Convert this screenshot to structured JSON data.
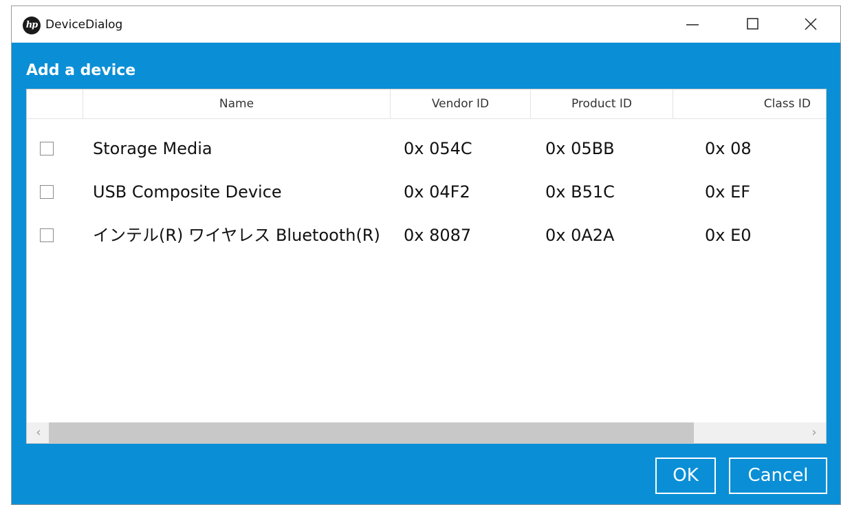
{
  "window": {
    "title": "DeviceDialog",
    "logo_text": "hp",
    "controls": {
      "minimize": "minimize-icon",
      "maximize": "maximize-icon",
      "close": "close-icon"
    }
  },
  "dialog": {
    "heading": "Add a device"
  },
  "table": {
    "columns": [
      "Name",
      "Vendor ID",
      "Product ID",
      "Class ID"
    ],
    "rows": [
      {
        "checked": false,
        "name": "Storage Media",
        "vendor_id": "0x 054C",
        "product_id": "0x 05BB",
        "class_id": "0x 08"
      },
      {
        "checked": false,
        "name": "USB Composite Device",
        "vendor_id": "0x 04F2",
        "product_id": "0x B51C",
        "class_id": "0x EF"
      },
      {
        "checked": false,
        "name": "インテル(R) ワイヤレス Bluetooth(R)",
        "vendor_id": "0x 8087",
        "product_id": "0x 0A2A",
        "class_id": "0x E0"
      }
    ],
    "scrollbar": {
      "left_arrow": "‹",
      "right_arrow": "›"
    }
  },
  "buttons": {
    "ok": "OK",
    "cancel": "Cancel"
  },
  "colors": {
    "accent": "#0a8fd6",
    "titlebar": "#ffffff",
    "list_background": "#ffffff"
  }
}
